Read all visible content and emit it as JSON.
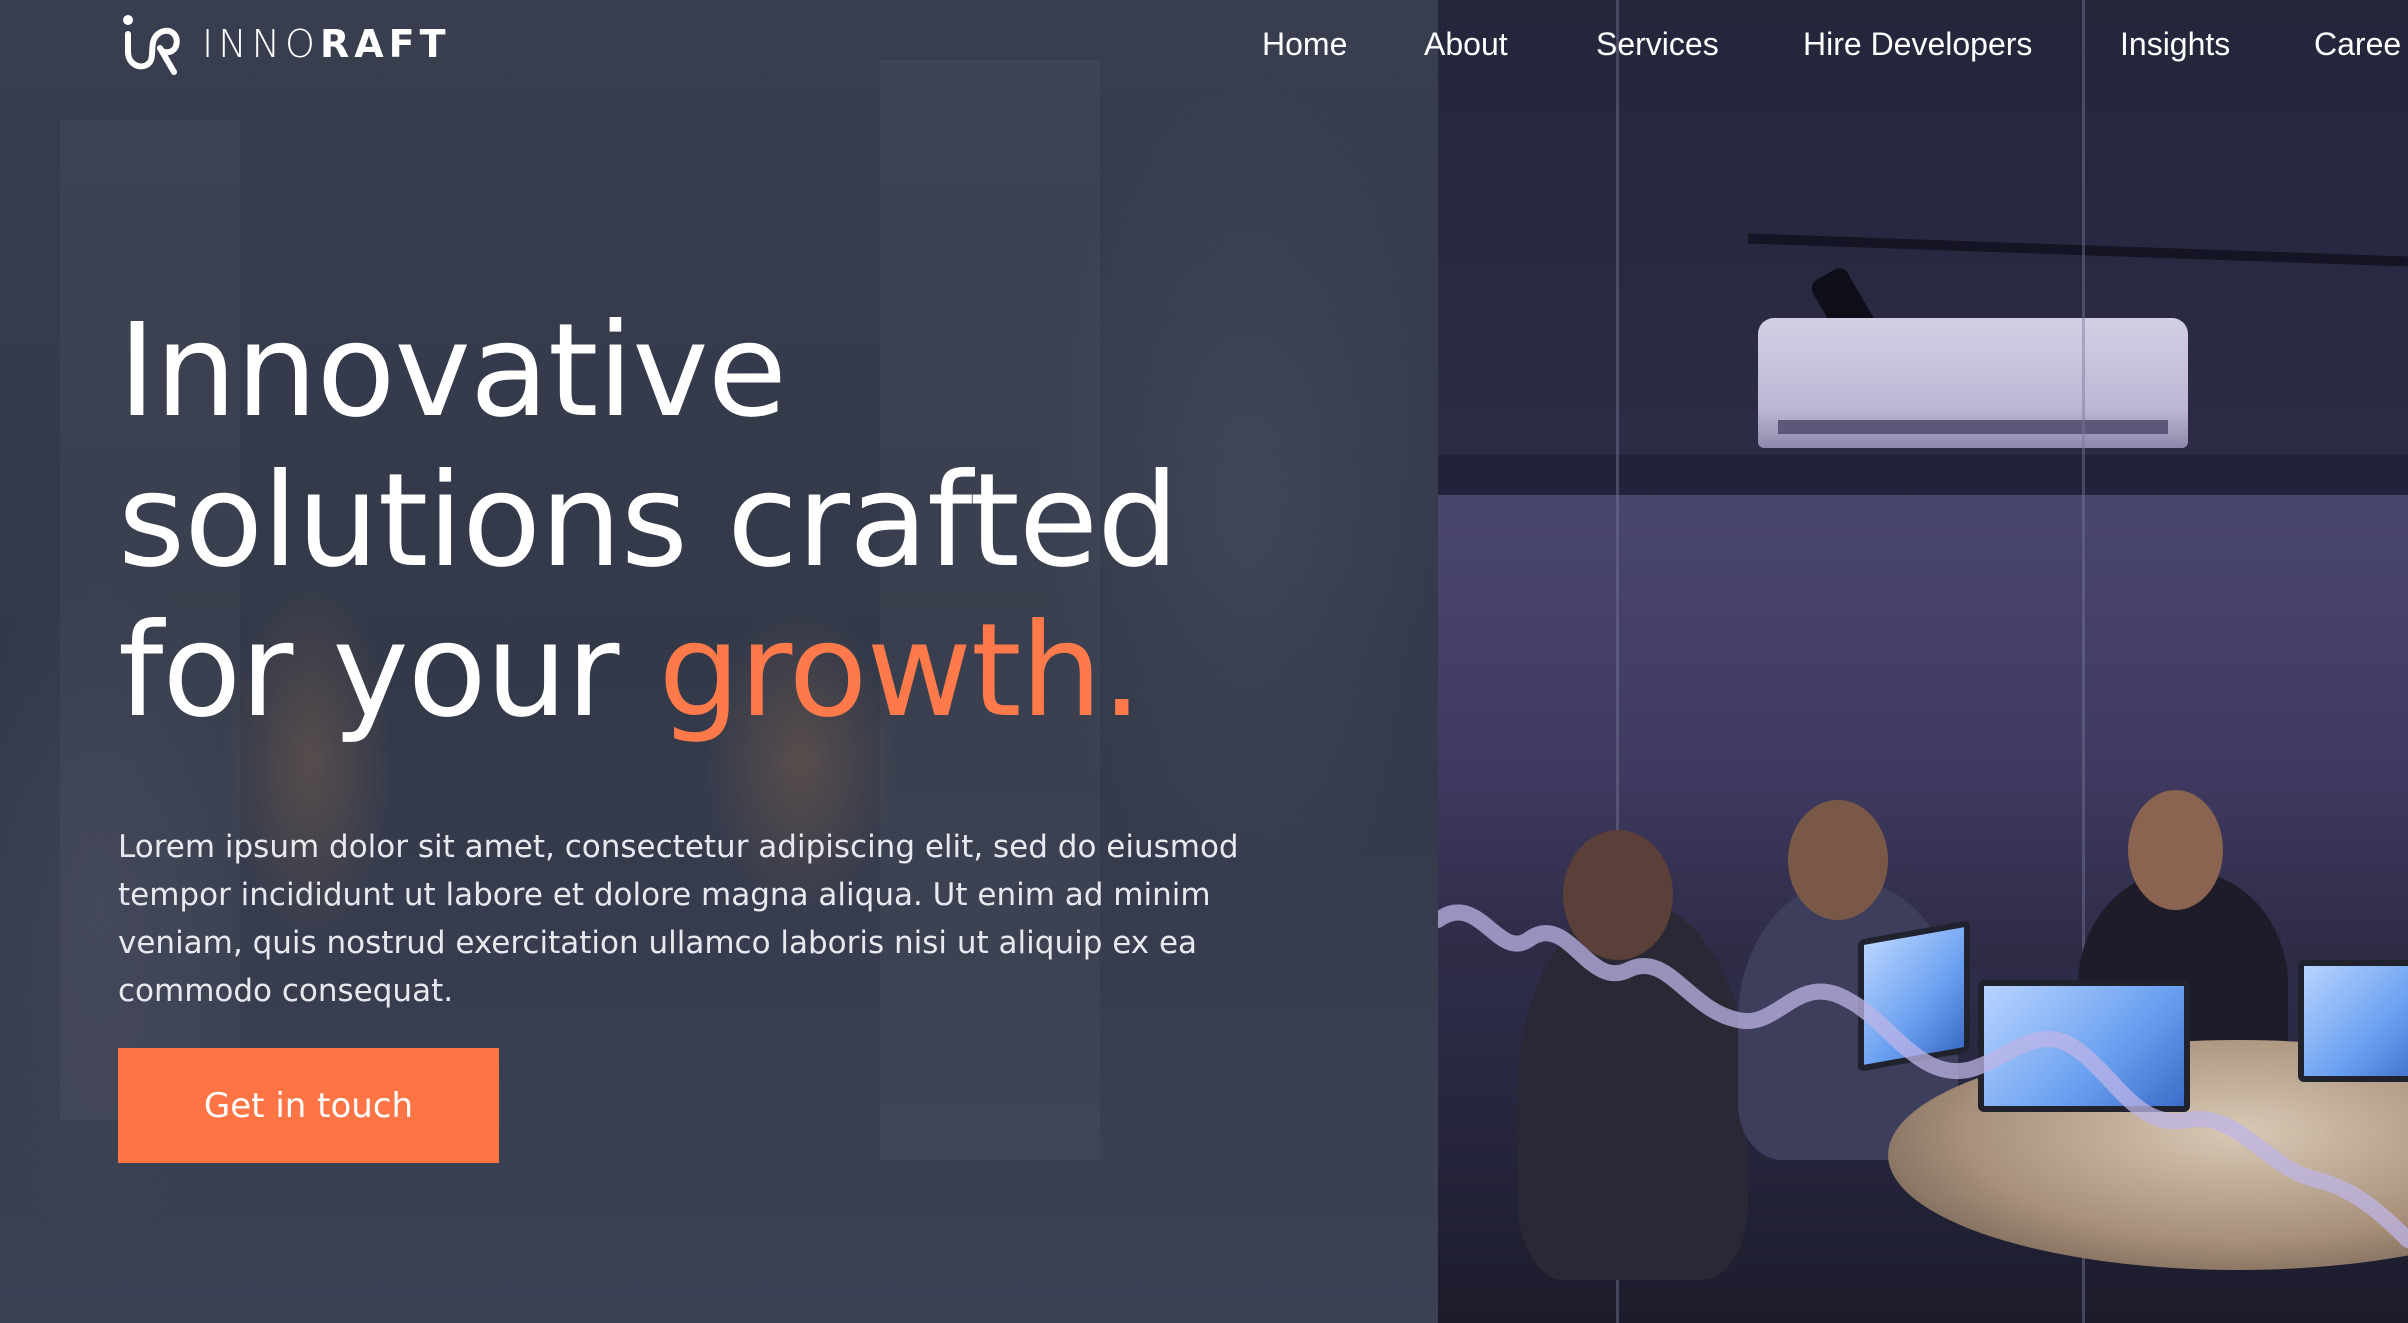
{
  "brand": {
    "name_light": "INNO",
    "name_bold": "RAFT",
    "accent_color": "#ff7445"
  },
  "nav": {
    "items": [
      {
        "label": "Home",
        "icon": null
      },
      {
        "label": "About",
        "icon": null
      },
      {
        "label": "Services",
        "icon": null
      },
      {
        "label": "Hire Developers",
        "icon": null
      },
      {
        "label": "Insights",
        "icon": null
      },
      {
        "label": "Caree",
        "icon": null
      }
    ]
  },
  "hero": {
    "title_line1": "Innovative",
    "title_line2": "solutions crafted",
    "title_line3_prefix": "for your ",
    "title_accent": "growth.",
    "body": "Lorem ipsum dolor sit amet, consectetur adipiscing elit, sed do eiusmod tempor incididunt ut labore et dolore magna aliqua. Ut enim ad minim veniam, quis nostrud exercitation ullamco laboris nisi ut aliquip ex ea commodo consequat.",
    "cta_label": "Get in touch"
  }
}
